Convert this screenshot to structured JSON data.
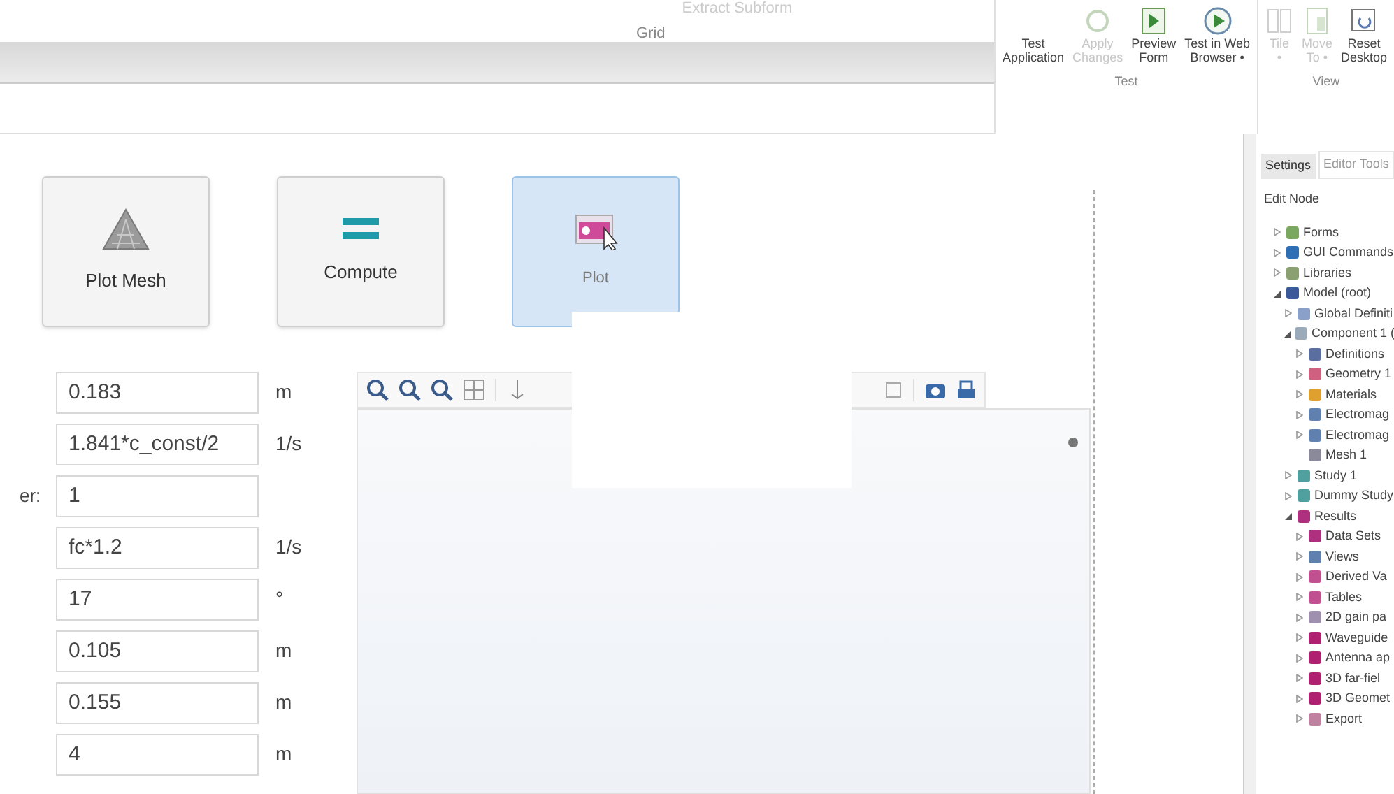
{
  "ribbon": {
    "grid_label": "Grid",
    "faded_command": "Extract Subform",
    "groups": [
      {
        "label": "Test",
        "buttons": [
          {
            "kind": "text",
            "lines": [
              "Test",
              "Application"
            ],
            "disabled": false
          },
          {
            "kind": "apply",
            "lines": [
              "Apply",
              "Changes"
            ],
            "disabled": true
          },
          {
            "kind": "preview",
            "lines": [
              "Preview",
              "Form"
            ],
            "disabled": false
          },
          {
            "kind": "web",
            "lines": [
              "Test in Web",
              "Browser •"
            ],
            "disabled": false
          }
        ]
      },
      {
        "label": "View",
        "buttons": [
          {
            "kind": "tile",
            "lines": [
              "Tile",
              "•"
            ],
            "disabled": true
          },
          {
            "kind": "move",
            "lines": [
              "Move",
              "To •"
            ],
            "disabled": true
          },
          {
            "kind": "reset",
            "lines": [
              "Reset",
              "Desktop"
            ],
            "disabled": false
          }
        ]
      }
    ]
  },
  "form_buttons": [
    {
      "kind": "mesh",
      "label": "Plot Mesh",
      "selected": false
    },
    {
      "kind": "compute",
      "label": "Compute",
      "selected": false
    },
    {
      "kind": "plot",
      "label": "Plot",
      "selected": true
    }
  ],
  "fields": [
    {
      "value": "0.183",
      "unit": "m"
    },
    {
      "value": "1.841*c_const/2",
      "unit": "1/s"
    },
    {
      "label": "er:",
      "value": "1"
    },
    {
      "value": "fc*1.2",
      "unit": "1/s"
    },
    {
      "value": "17",
      "unit": "°"
    },
    {
      "value": "0.105",
      "unit": "m"
    },
    {
      "value": "0.155",
      "unit": "m"
    },
    {
      "value": "4",
      "unit": "m"
    }
  ],
  "panel": {
    "tabs": [
      {
        "label": "Settings",
        "selected": true
      },
      {
        "label": "Editor Tools",
        "selected": false
      }
    ],
    "edit_node": "Edit Node",
    "tree": [
      {
        "label": "Forms",
        "expanded": false,
        "color": "#7aa860"
      },
      {
        "label": "GUI Commands",
        "expanded": false,
        "color": "#2f6fb5"
      },
      {
        "label": "Libraries",
        "expanded": false,
        "color": "#8aa070"
      },
      {
        "label": "Model (root)",
        "expanded": true,
        "color": "#3a5a9a",
        "children": [
          {
            "label": "Global Definiti",
            "expanded": false,
            "color": "#8aa0c8"
          },
          {
            "label": "Component 1 (",
            "expanded": true,
            "color": "#9aaab8",
            "children": [
              {
                "label": "Definitions",
                "expanded": false,
                "color": "#5a6fa0"
              },
              {
                "label": "Geometry 1",
                "expanded": false,
                "color": "#d06080"
              },
              {
                "label": "Materials",
                "expanded": false,
                "color": "#e0a030"
              },
              {
                "label": "Electromag",
                "expanded": false,
                "color": "#6080b0"
              },
              {
                "label": "Electromag",
                "expanded": false,
                "color": "#6080b0"
              },
              {
                "label": "Mesh 1",
                "color": "#8a8a9a"
              }
            ]
          },
          {
            "label": "Study 1",
            "expanded": false,
            "color": "#50a0a0"
          },
          {
            "label": "Dummy Study",
            "expanded": false,
            "color": "#50a0a0"
          },
          {
            "label": "Results",
            "expanded": true,
            "color": "#b03080",
            "children": [
              {
                "label": "Data Sets",
                "expanded": false,
                "color": "#b03080"
              },
              {
                "label": "Views",
                "expanded": false,
                "color": "#6080b0"
              },
              {
                "label": "Derived Va",
                "expanded": false,
                "color": "#c05090"
              },
              {
                "label": "Tables",
                "expanded": false,
                "color": "#c05090"
              },
              {
                "label": "2D gain pa",
                "expanded": false,
                "color": "#a090b0"
              },
              {
                "label": "Waveguide",
                "expanded": false,
                "color": "#b02070"
              },
              {
                "label": "Antenna ap",
                "expanded": false,
                "color": "#b02070"
              },
              {
                "label": "3D far-fiel",
                "expanded": false,
                "color": "#b02070"
              },
              {
                "label": "3D Geomet",
                "expanded": false,
                "color": "#b02070"
              },
              {
                "label": "Export",
                "expanded": false,
                "color": "#c080a0"
              }
            ]
          }
        ]
      }
    ]
  }
}
